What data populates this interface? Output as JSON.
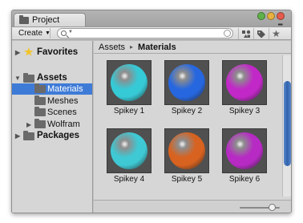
{
  "window": {
    "tab_title": "Project",
    "traffic_lights": {
      "close": "#e35b4c",
      "minimize": "#e8b13d",
      "zoom": "#5fb24a"
    },
    "tab_menu_icon": "menu-dots-icon"
  },
  "toolbar": {
    "create_label": "Create",
    "search_placeholder": "",
    "icons": [
      "filter-by-type-icon",
      "filter-by-label-icon",
      "favorite-star-icon"
    ]
  },
  "sidebar": {
    "items": [
      {
        "label": "Favorites",
        "icon": "star-icon",
        "expanded": false,
        "bold": true
      },
      {
        "label": "Assets",
        "icon": "folder-icon",
        "expanded": true,
        "bold": true
      },
      {
        "label": "Materials",
        "icon": "folder-icon",
        "selected": true
      },
      {
        "label": "Meshes",
        "icon": "folder-icon"
      },
      {
        "label": "Scenes",
        "icon": "folder-icon"
      },
      {
        "label": "Wolfram",
        "icon": "folder-icon",
        "expanded": false
      },
      {
        "label": "Packages",
        "icon": "folder-icon",
        "expanded": false,
        "bold": true
      }
    ]
  },
  "breadcrumb": {
    "root": "Assets",
    "separator": "▸",
    "current": "Materials"
  },
  "assets": [
    {
      "name": "Spikey 1",
      "color": "#36c9d6"
    },
    {
      "name": "Spikey 2",
      "color": "#2667e0"
    },
    {
      "name": "Spikey 3",
      "color": "#c227c8"
    },
    {
      "name": "Spikey 4",
      "color": "#3ec9d4"
    },
    {
      "name": "Spikey 5",
      "color": "#d8621f"
    },
    {
      "name": "Spikey 6",
      "color": "#b72ac4"
    }
  ],
  "zoom_level": 0.8,
  "accent_color": "#3e7bd7"
}
